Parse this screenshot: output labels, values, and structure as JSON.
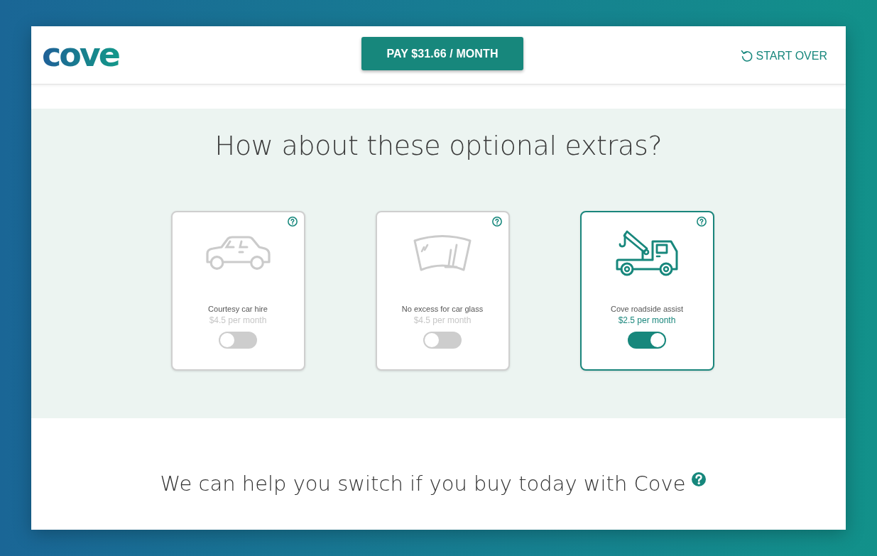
{
  "logo": "cove",
  "header": {
    "pay_button": "PAY $31.66 / MONTH",
    "start_over": "START OVER"
  },
  "extras": {
    "heading": "How about these optional extras?",
    "items": [
      {
        "kind": "car",
        "title": "Courtesy car hire",
        "price": "$4.5 per month",
        "on": false
      },
      {
        "kind": "windscreen",
        "title": "No excess for car glass",
        "price": "$4.5 per month",
        "on": false
      },
      {
        "kind": "tow-truck",
        "title": "Cove roadside assist",
        "price": "$2.5 per month",
        "on": true
      }
    ]
  },
  "switch_help": {
    "text": "We can help you switch if you buy today with Cove"
  }
}
